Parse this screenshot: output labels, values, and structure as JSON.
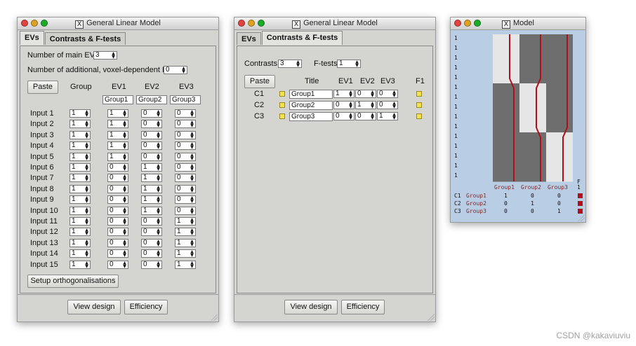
{
  "win1": {
    "title": "General Linear Model",
    "tabs": [
      "EVs",
      "Contrasts & F-tests"
    ],
    "num_main_evs_label": "Number of main EVs",
    "num_main_evs": "3",
    "num_additional_label": "Number of additional, voxel-dependent EVs",
    "num_additional": "0",
    "paste_label": "Paste",
    "col_group": "Group",
    "col_ev1": "EV1",
    "col_ev2": "EV2",
    "col_ev3": "EV3",
    "ev_names": [
      "Group1",
      "Group2",
      "Group3"
    ],
    "rows": [
      {
        "label": "Input 1",
        "group": "1",
        "ev1": "1",
        "ev2": "0",
        "ev3": "0"
      },
      {
        "label": "Input 2",
        "group": "1",
        "ev1": "1",
        "ev2": "0",
        "ev3": "0"
      },
      {
        "label": "Input 3",
        "group": "1",
        "ev1": "1",
        "ev2": "0",
        "ev3": "0"
      },
      {
        "label": "Input 4",
        "group": "1",
        "ev1": "1",
        "ev2": "0",
        "ev3": "0"
      },
      {
        "label": "Input 5",
        "group": "1",
        "ev1": "1",
        "ev2": "0",
        "ev3": "0"
      },
      {
        "label": "Input 6",
        "group": "1",
        "ev1": "0",
        "ev2": "1",
        "ev3": "0"
      },
      {
        "label": "Input 7",
        "group": "1",
        "ev1": "0",
        "ev2": "1",
        "ev3": "0"
      },
      {
        "label": "Input 8",
        "group": "1",
        "ev1": "0",
        "ev2": "1",
        "ev3": "0"
      },
      {
        "label": "Input 9",
        "group": "1",
        "ev1": "0",
        "ev2": "1",
        "ev3": "0"
      },
      {
        "label": "Input 10",
        "group": "1",
        "ev1": "0",
        "ev2": "1",
        "ev3": "0"
      },
      {
        "label": "Input 11",
        "group": "1",
        "ev1": "0",
        "ev2": "0",
        "ev3": "1"
      },
      {
        "label": "Input 12",
        "group": "1",
        "ev1": "0",
        "ev2": "0",
        "ev3": "1"
      },
      {
        "label": "Input 13",
        "group": "1",
        "ev1": "0",
        "ev2": "0",
        "ev3": "1"
      },
      {
        "label": "Input 14",
        "group": "1",
        "ev1": "0",
        "ev2": "0",
        "ev3": "1"
      },
      {
        "label": "Input 15",
        "group": "1",
        "ev1": "0",
        "ev2": "0",
        "ev3": "1"
      }
    ],
    "setup_orth_label": "Setup orthogonalisations",
    "view_design_label": "View design",
    "efficiency_label": "Efficiency"
  },
  "win2": {
    "title": "General Linear Model",
    "tabs": [
      "EVs",
      "Contrasts & F-tests"
    ],
    "contrasts_label": "Contrasts",
    "contrasts_value": "3",
    "ftests_label": "F-tests",
    "ftests_value": "1",
    "paste_label": "Paste",
    "col_title": "Title",
    "col_ev1": "EV1",
    "col_ev2": "EV2",
    "col_ev3": "EV3",
    "col_f1": "F1",
    "rows": [
      {
        "label": "C1",
        "title": "Group1",
        "ev1": "1",
        "ev2": "0",
        "ev3": "0"
      },
      {
        "label": "C2",
        "title": "Group2",
        "ev1": "0",
        "ev2": "1",
        "ev3": "0"
      },
      {
        "label": "C3",
        "title": "Group3",
        "ev1": "0",
        "ev2": "0",
        "ev3": "1"
      }
    ],
    "view_design_label": "View design",
    "efficiency_label": "Efficiency"
  },
  "win3": {
    "title": "Model",
    "row_ones": [
      "1",
      "1",
      "1",
      "1",
      "1",
      "1",
      "1",
      "1",
      "1",
      "1",
      "1",
      "1",
      "1",
      "1",
      "1"
    ],
    "ev_labels": [
      "Group1",
      "Group2",
      "Group3"
    ],
    "f_header": "F",
    "f_header_num": "1",
    "contrast_rows": [
      {
        "id": "C1",
        "name": "Group1",
        "v1": "1",
        "v2": "0",
        "v3": "0"
      },
      {
        "id": "C2",
        "name": "Group2",
        "v1": "0",
        "v2": "1",
        "v3": "0"
      },
      {
        "id": "C3",
        "name": "Group3",
        "v1": "0",
        "v2": "0",
        "v3": "1"
      }
    ],
    "design_matrix": [
      [
        1,
        0,
        0
      ],
      [
        1,
        0,
        0
      ],
      [
        1,
        0,
        0
      ],
      [
        1,
        0,
        0
      ],
      [
        1,
        0,
        0
      ],
      [
        0,
        1,
        0
      ],
      [
        0,
        1,
        0
      ],
      [
        0,
        1,
        0
      ],
      [
        0,
        1,
        0
      ],
      [
        0,
        1,
        0
      ],
      [
        0,
        0,
        1
      ],
      [
        0,
        0,
        1
      ],
      [
        0,
        0,
        1
      ],
      [
        0,
        0,
        1
      ],
      [
        0,
        0,
        1
      ]
    ],
    "colors": {
      "high": "#e6e6e6",
      "low": "#6e6e6e",
      "regressor": "#b0101a",
      "background": "#b9cde4"
    }
  },
  "watermark": "CSDN @kakaviuviu"
}
